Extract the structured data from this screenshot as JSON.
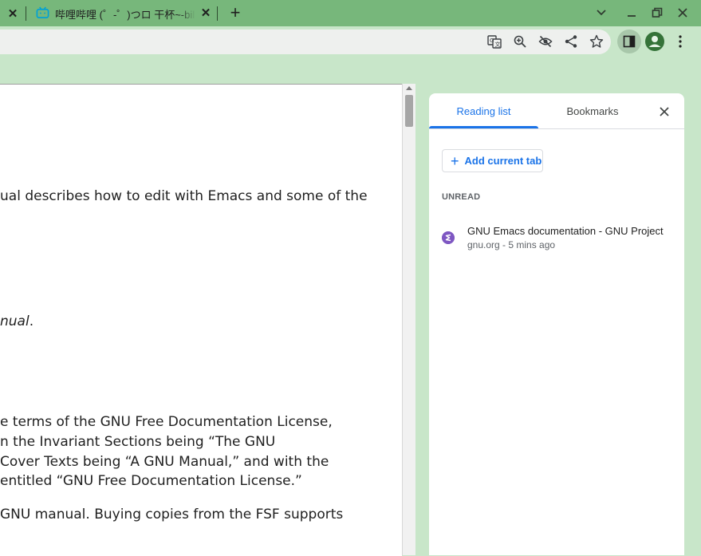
{
  "tabs": [
    {
      "title": "哔哩哔哩 (゜-゜)つロ 干杯~-bilibili",
      "favicon": "bilibili-icon"
    }
  ],
  "window_controls": [
    "chevron-down-icon",
    "minimize-icon",
    "restore-icon",
    "close-icon"
  ],
  "toolbar_icons": [
    "translate-icon",
    "zoom-icon",
    "eye-off-icon",
    "share-icon",
    "star-icon",
    "side-panel-icon",
    "profile-icon",
    "more-vert-icon"
  ],
  "document": {
    "lines": [
      "ual describes how to edit with Emacs and some of the",
      "nual",
      ".",
      "e terms of the GNU Free Documentation License,",
      "n the Invariant Sections being “The GNU",
      "Cover Texts being “A GNU Manual,” and with the",
      "entitled “GNU Free Documentation License.”",
      "GNU manual. Buying copies from the FSF supports"
    ]
  },
  "side_panel": {
    "tabs": [
      "Reading list",
      "Bookmarks"
    ],
    "active_tab": "Reading list",
    "add_button": "Add current tab",
    "section": "UNREAD",
    "items": [
      {
        "title": "GNU Emacs documentation - GNU Project",
        "meta": "gnu.org - 5 mins ago"
      }
    ]
  },
  "colors": {
    "frame": "#77b77b",
    "toolbar": "#c8e6c9",
    "accent": "#1a73e8"
  }
}
